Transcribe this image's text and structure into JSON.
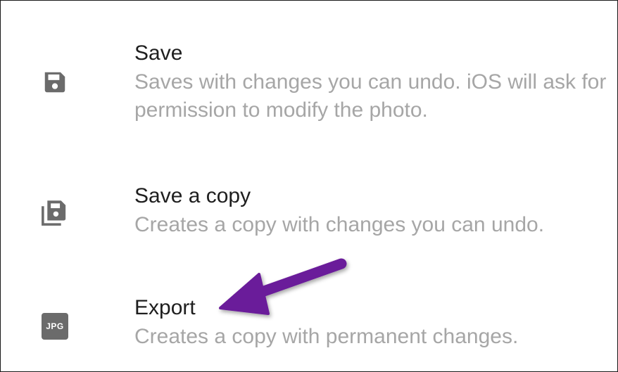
{
  "options": [
    {
      "icon": "save-icon",
      "title": "Save",
      "description": "Saves with changes you can undo. iOS will ask for permission to modify the photo."
    },
    {
      "icon": "save-copy-icon",
      "title": "Save a copy",
      "description": "Creates a copy with changes you can undo."
    },
    {
      "icon": "jpg-icon",
      "icon_text": "JPG",
      "title": "Export",
      "description": "Creates a copy with permanent changes."
    }
  ],
  "annotation": {
    "arrow_color": "#6a1b9a",
    "points_to": "Export"
  },
  "colors": {
    "title": "#1e1e1e",
    "description": "#a6a6a6",
    "icon": "#6b6b6b"
  }
}
